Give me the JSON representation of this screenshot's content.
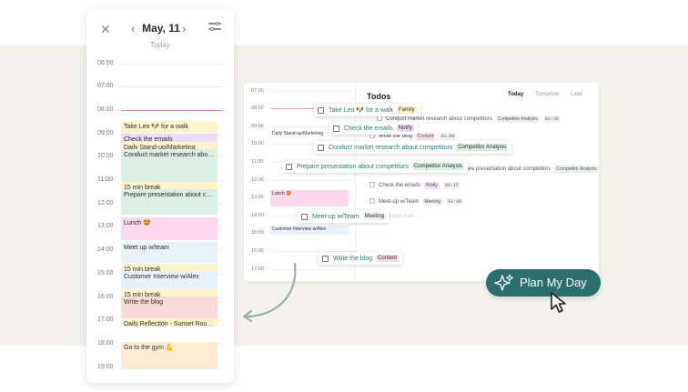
{
  "phone": {
    "date": "May, 11",
    "subtitle": "Today",
    "hours": [
      "06:00",
      "07:00",
      "08:00",
      "09:00",
      "10:00",
      "11:00",
      "12:00",
      "13:00",
      "14:00",
      "15:00",
      "16:00",
      "17:00",
      "18:00",
      "19:00"
    ],
    "events": [
      {
        "label": "Take Leo 🐶 for a walk",
        "color": "#fbf4cc"
      },
      {
        "label": "Check the emails",
        "color": "#ecdcf6"
      },
      {
        "label": "Daily Stand-up/Marketing",
        "color": "#fbf4cc"
      },
      {
        "label": "Conduct market research about co...",
        "color": "#dcefe2"
      },
      {
        "label": "15 min break",
        "color": "#fbf4cc"
      },
      {
        "label": "Prepare presentation about compe...",
        "color": "#dcefe2"
      },
      {
        "label": "Lunch 🤩",
        "color": "#fad8ef"
      },
      {
        "label": "Meet up w/team",
        "color": "#e9f1fb"
      },
      {
        "label": "15 min break",
        "color": "#fbf4cc"
      },
      {
        "label": "Customer Interview w/Alex",
        "color": "#e9f1fb"
      },
      {
        "label": "15 min break",
        "color": "#fbf4cc"
      },
      {
        "label": "Write the blog",
        "color": "#fad9d9"
      },
      {
        "label": "Daily Reflection - Sunset Routine 🌞",
        "color": "#fbf4cc"
      },
      {
        "label": "Go to the gym 💪",
        "color": "#fdecd4"
      }
    ]
  },
  "app": {
    "hours": [
      "07:00",
      "08:00",
      "09:00",
      "10:00",
      "11:00",
      "12:00",
      "13:00",
      "14:00",
      "15:00",
      "16:00",
      "17:00"
    ],
    "cal_events": [
      {
        "label": "Daily Stand-up/Marketing",
        "color": "#ffffff"
      },
      {
        "label": "Lunch 🤩",
        "color": "#fad8ef"
      },
      {
        "label": "Customer Interview w/Alex",
        "color": "#e9f1fb"
      }
    ],
    "todos_title": "Todos",
    "tabs": [
      "Today",
      "Tomorrow",
      "Later"
    ],
    "rows": [
      {
        "text": "Conduct market research about competitors",
        "tag": "Competitor Analysis",
        "tag_color": "#e6f1e8",
        "dur": "01:30"
      },
      {
        "text": "Write the blog",
        "tag": "Content",
        "tag_color": "#fbe0e0",
        "dur": "01:00"
      },
      {
        "text": "Prepare presentation about competitors",
        "tag": "Competitor Analysis",
        "tag_color": "#e6f1e8",
        "dur": "01:15"
      },
      {
        "text": "Check the emails",
        "tag": "Notify",
        "tag_color": "#efe2f7",
        "dur": "00:15"
      },
      {
        "text": "Meet-up w/Team",
        "tag": "Meeting",
        "tag_color": "#f0f0f0",
        "dur": "01:00"
      }
    ],
    "add_todo": "d new todo..."
  },
  "chips": [
    {
      "label": "Take Leo 🐶 for a walk",
      "tag": "Family",
      "tag_color": "#fbf1c4"
    },
    {
      "label": "Check the emails",
      "tag": "Notify",
      "tag_color": "#ecd9f6"
    },
    {
      "label": "Conduct market research about competitors",
      "tag": "Competitor Analysis",
      "tag_color": "#d9efdf"
    },
    {
      "label": "Prepare presentation about competitors",
      "tag": "Competitor Analysis",
      "tag_color": "#d9efdf"
    },
    {
      "label": "Meet-up w/Team",
      "tag": "Meeting",
      "tag_color": "#eeeeee"
    },
    {
      "label": "Write the blog",
      "tag": "Content",
      "tag_color": "#fbdcdc"
    }
  ],
  "cta": {
    "label": "Plan My Day",
    "color": "#2a6f6b"
  }
}
